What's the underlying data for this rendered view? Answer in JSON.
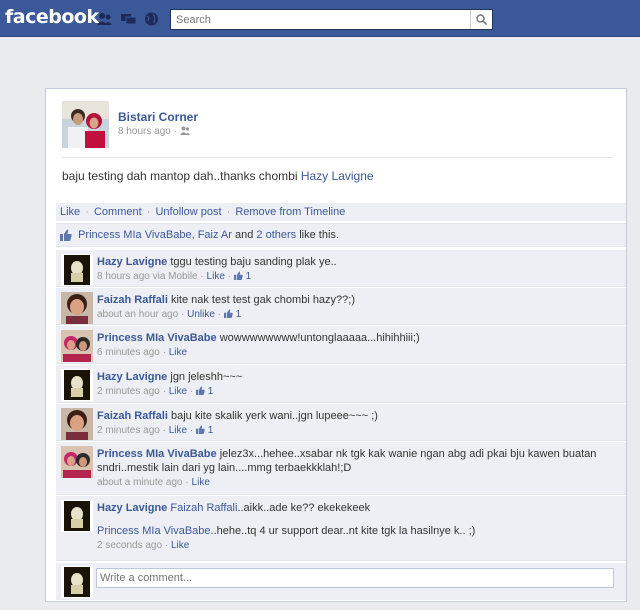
{
  "brand": {
    "logo": "facebook"
  },
  "search": {
    "placeholder": "Search"
  },
  "post": {
    "author": "Bistari Corner",
    "time": "8 hours ago",
    "dot": "·",
    "text": "baju testing dah mantop dah..thanks chombi",
    "tagged": "Hazy Lavigne"
  },
  "actions": {
    "like": "Like",
    "comment": "Comment",
    "unfollow": "Unfollow post",
    "remove": "Remove from Timeline",
    "sep": "·"
  },
  "likes": {
    "names": "Princess MIa VivaBabe, Faiz Ar",
    "and": "and",
    "others": "2 others",
    "suffix": "like this."
  },
  "comments": [
    {
      "author": "Hazy Lavigne",
      "text": "tggu testing baju sanding plak ye..",
      "time": "8 hours ago via Mobile",
      "action": "Like",
      "likes": "1",
      "avatar": "ghost"
    },
    {
      "author": "Faizah Raffali",
      "text": "kite nak test test gak chombi hazy??;)",
      "time": "about an hour ago",
      "action": "Unlike",
      "likes": "1",
      "avatar": "girl"
    },
    {
      "author": "Princess MIa VivaBabe",
      "text": "wowwwwwwww!untonglaaaaa...hihihhiii;)",
      "time": "6 minutes ago",
      "action": "Like",
      "likes": "",
      "avatar": "couple"
    },
    {
      "author": "Hazy Lavigne",
      "text": "jgn jeleshh~~~",
      "time": "2 minutes ago",
      "action": "Like",
      "likes": "1",
      "avatar": "ghost"
    },
    {
      "author": "Faizah Raffali",
      "text": "baju kite skalik yerk wani..jgn lupeee~~~ ;)",
      "time": "2 minutes ago",
      "action": "Like",
      "likes": "1",
      "avatar": "girl"
    },
    {
      "author": "Princess MIa VivaBabe",
      "text": "jelez3x...hehee..xsabar nk tgk kak wanie ngan abg adi pkai bju kawen buatan sndri..mestik lain dari yg lain....mmg terbaekkklah!;D",
      "time": "about a minute ago",
      "action": "Like",
      "likes": "",
      "avatar": "couple"
    },
    {
      "author": "Hazy Lavigne",
      "text": "",
      "mention": "Faizah Raffali",
      "mention_rest": "..aikk..ade ke?? ekekekeek",
      "mention2": "Princess MIa VivaBabe",
      "rest2": "..hehe..tq 4 ur support dear..nt kite tgk la hasilnye k.. ;)",
      "time": "2 seconds ago",
      "action": "Like",
      "likes": "",
      "avatar": "ghost"
    }
  ],
  "write": {
    "placeholder": "Write a comment..."
  }
}
